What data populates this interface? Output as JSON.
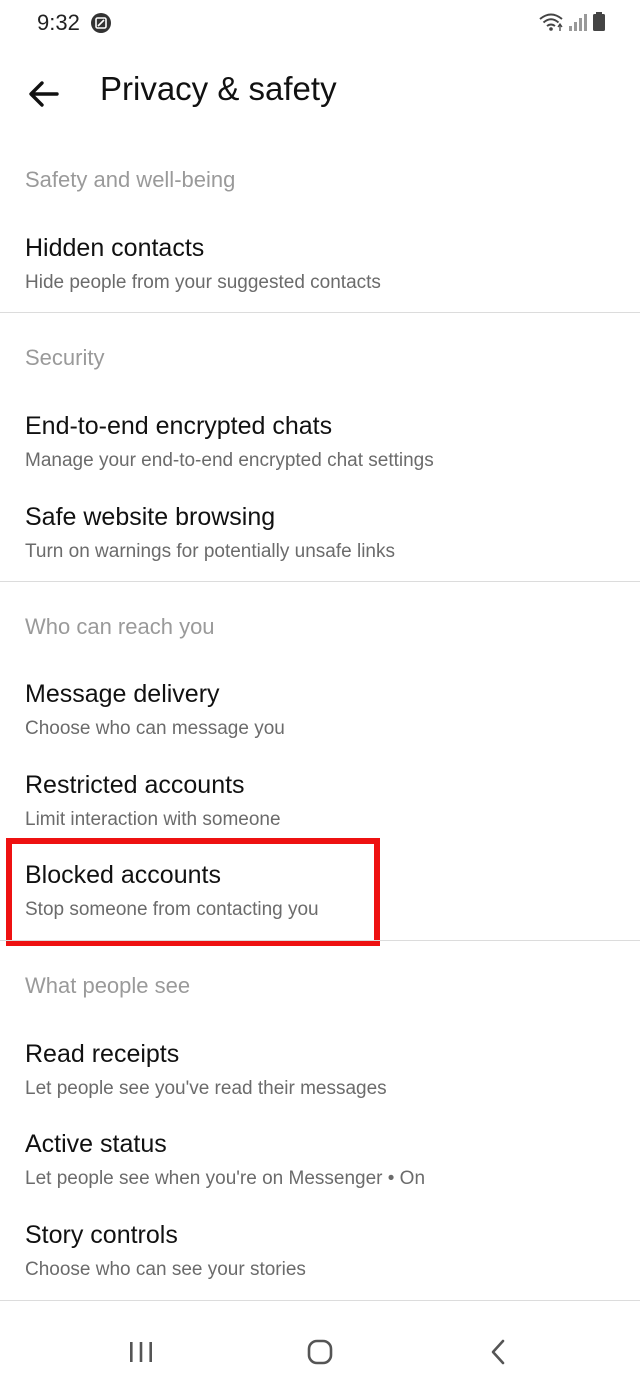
{
  "status_bar": {
    "time": "9:32"
  },
  "header": {
    "title": "Privacy & safety"
  },
  "sections": [
    {
      "header": "Safety and well-being",
      "items": [
        {
          "title": "Hidden contacts",
          "subtitle": "Hide people from your suggested contacts"
        }
      ]
    },
    {
      "header": "Security",
      "items": [
        {
          "title": "End-to-end encrypted chats",
          "subtitle": "Manage your end-to-end encrypted chat settings"
        },
        {
          "title": "Safe website browsing",
          "subtitle": "Turn on warnings for potentially unsafe links"
        }
      ]
    },
    {
      "header": "Who can reach you",
      "items": [
        {
          "title": "Message delivery",
          "subtitle": "Choose who can message you"
        },
        {
          "title": "Restricted accounts",
          "subtitle": "Limit interaction with someone"
        },
        {
          "title": "Blocked accounts",
          "subtitle": "Stop someone from contacting you"
        }
      ]
    },
    {
      "header": "What people see",
      "items": [
        {
          "title": "Read receipts",
          "subtitle": "Let people see you've read their messages"
        },
        {
          "title": "Active status",
          "subtitle": "Let people see when you're on Messenger • On"
        },
        {
          "title": "Story controls",
          "subtitle": "Choose who can see your stories"
        }
      ]
    }
  ],
  "highlight_color": "#ee1111",
  "icons": {
    "back": "arrow-left-icon",
    "recents": "recent-apps-icon",
    "home": "home-icon",
    "nav_back": "chevron-left-icon"
  }
}
